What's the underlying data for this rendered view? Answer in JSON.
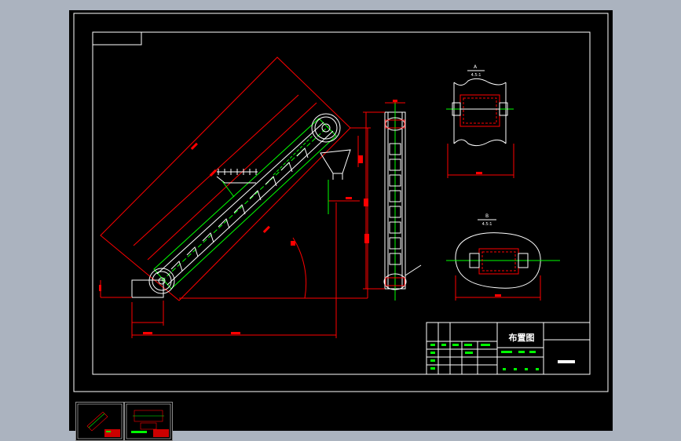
{
  "drawing": {
    "title_block": {
      "drawing_title": "布置图"
    },
    "view_a": {
      "label": "A",
      "scale": "4.5:1"
    },
    "view_b": {
      "label": "B",
      "scale": "4.5:1"
    }
  },
  "layouts": [
    {
      "name": "layout-tab-1"
    },
    {
      "name": "layout-tab-2"
    }
  ],
  "colors": {
    "workspace": "#abb3bf",
    "paper": "#000000",
    "frame": "#ffffff",
    "dimension": "#ff0000",
    "center_line": "#00ff00",
    "object": "#ffffff",
    "hatch": "#ff0000"
  }
}
